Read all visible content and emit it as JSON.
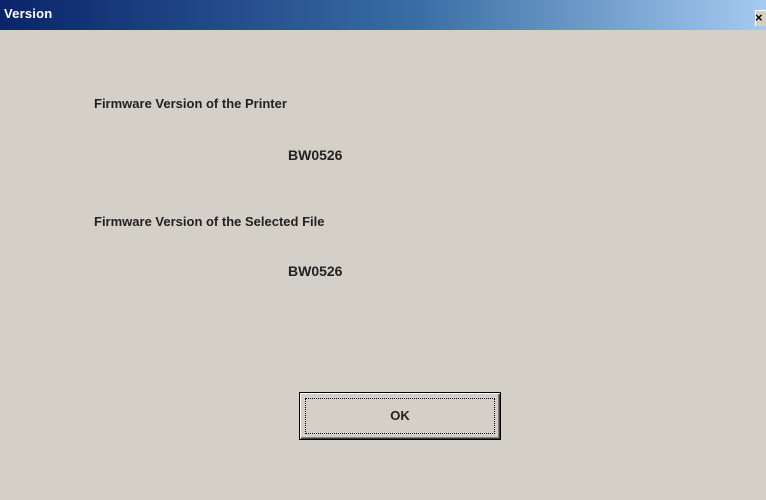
{
  "window": {
    "title": "Version",
    "close_glyph": "×"
  },
  "printer_firmware": {
    "label": "Firmware Version of the Printer",
    "value": "BW0526"
  },
  "file_firmware": {
    "label": "Firmware Version of the Selected File",
    "value": "BW0526"
  },
  "buttons": {
    "ok_label": "OK"
  },
  "colors": {
    "dialog_background": "#d4d0c8",
    "titlebar_start": "#0a246a",
    "titlebar_end": "#a6caf0",
    "title_text": "#ffffff"
  }
}
